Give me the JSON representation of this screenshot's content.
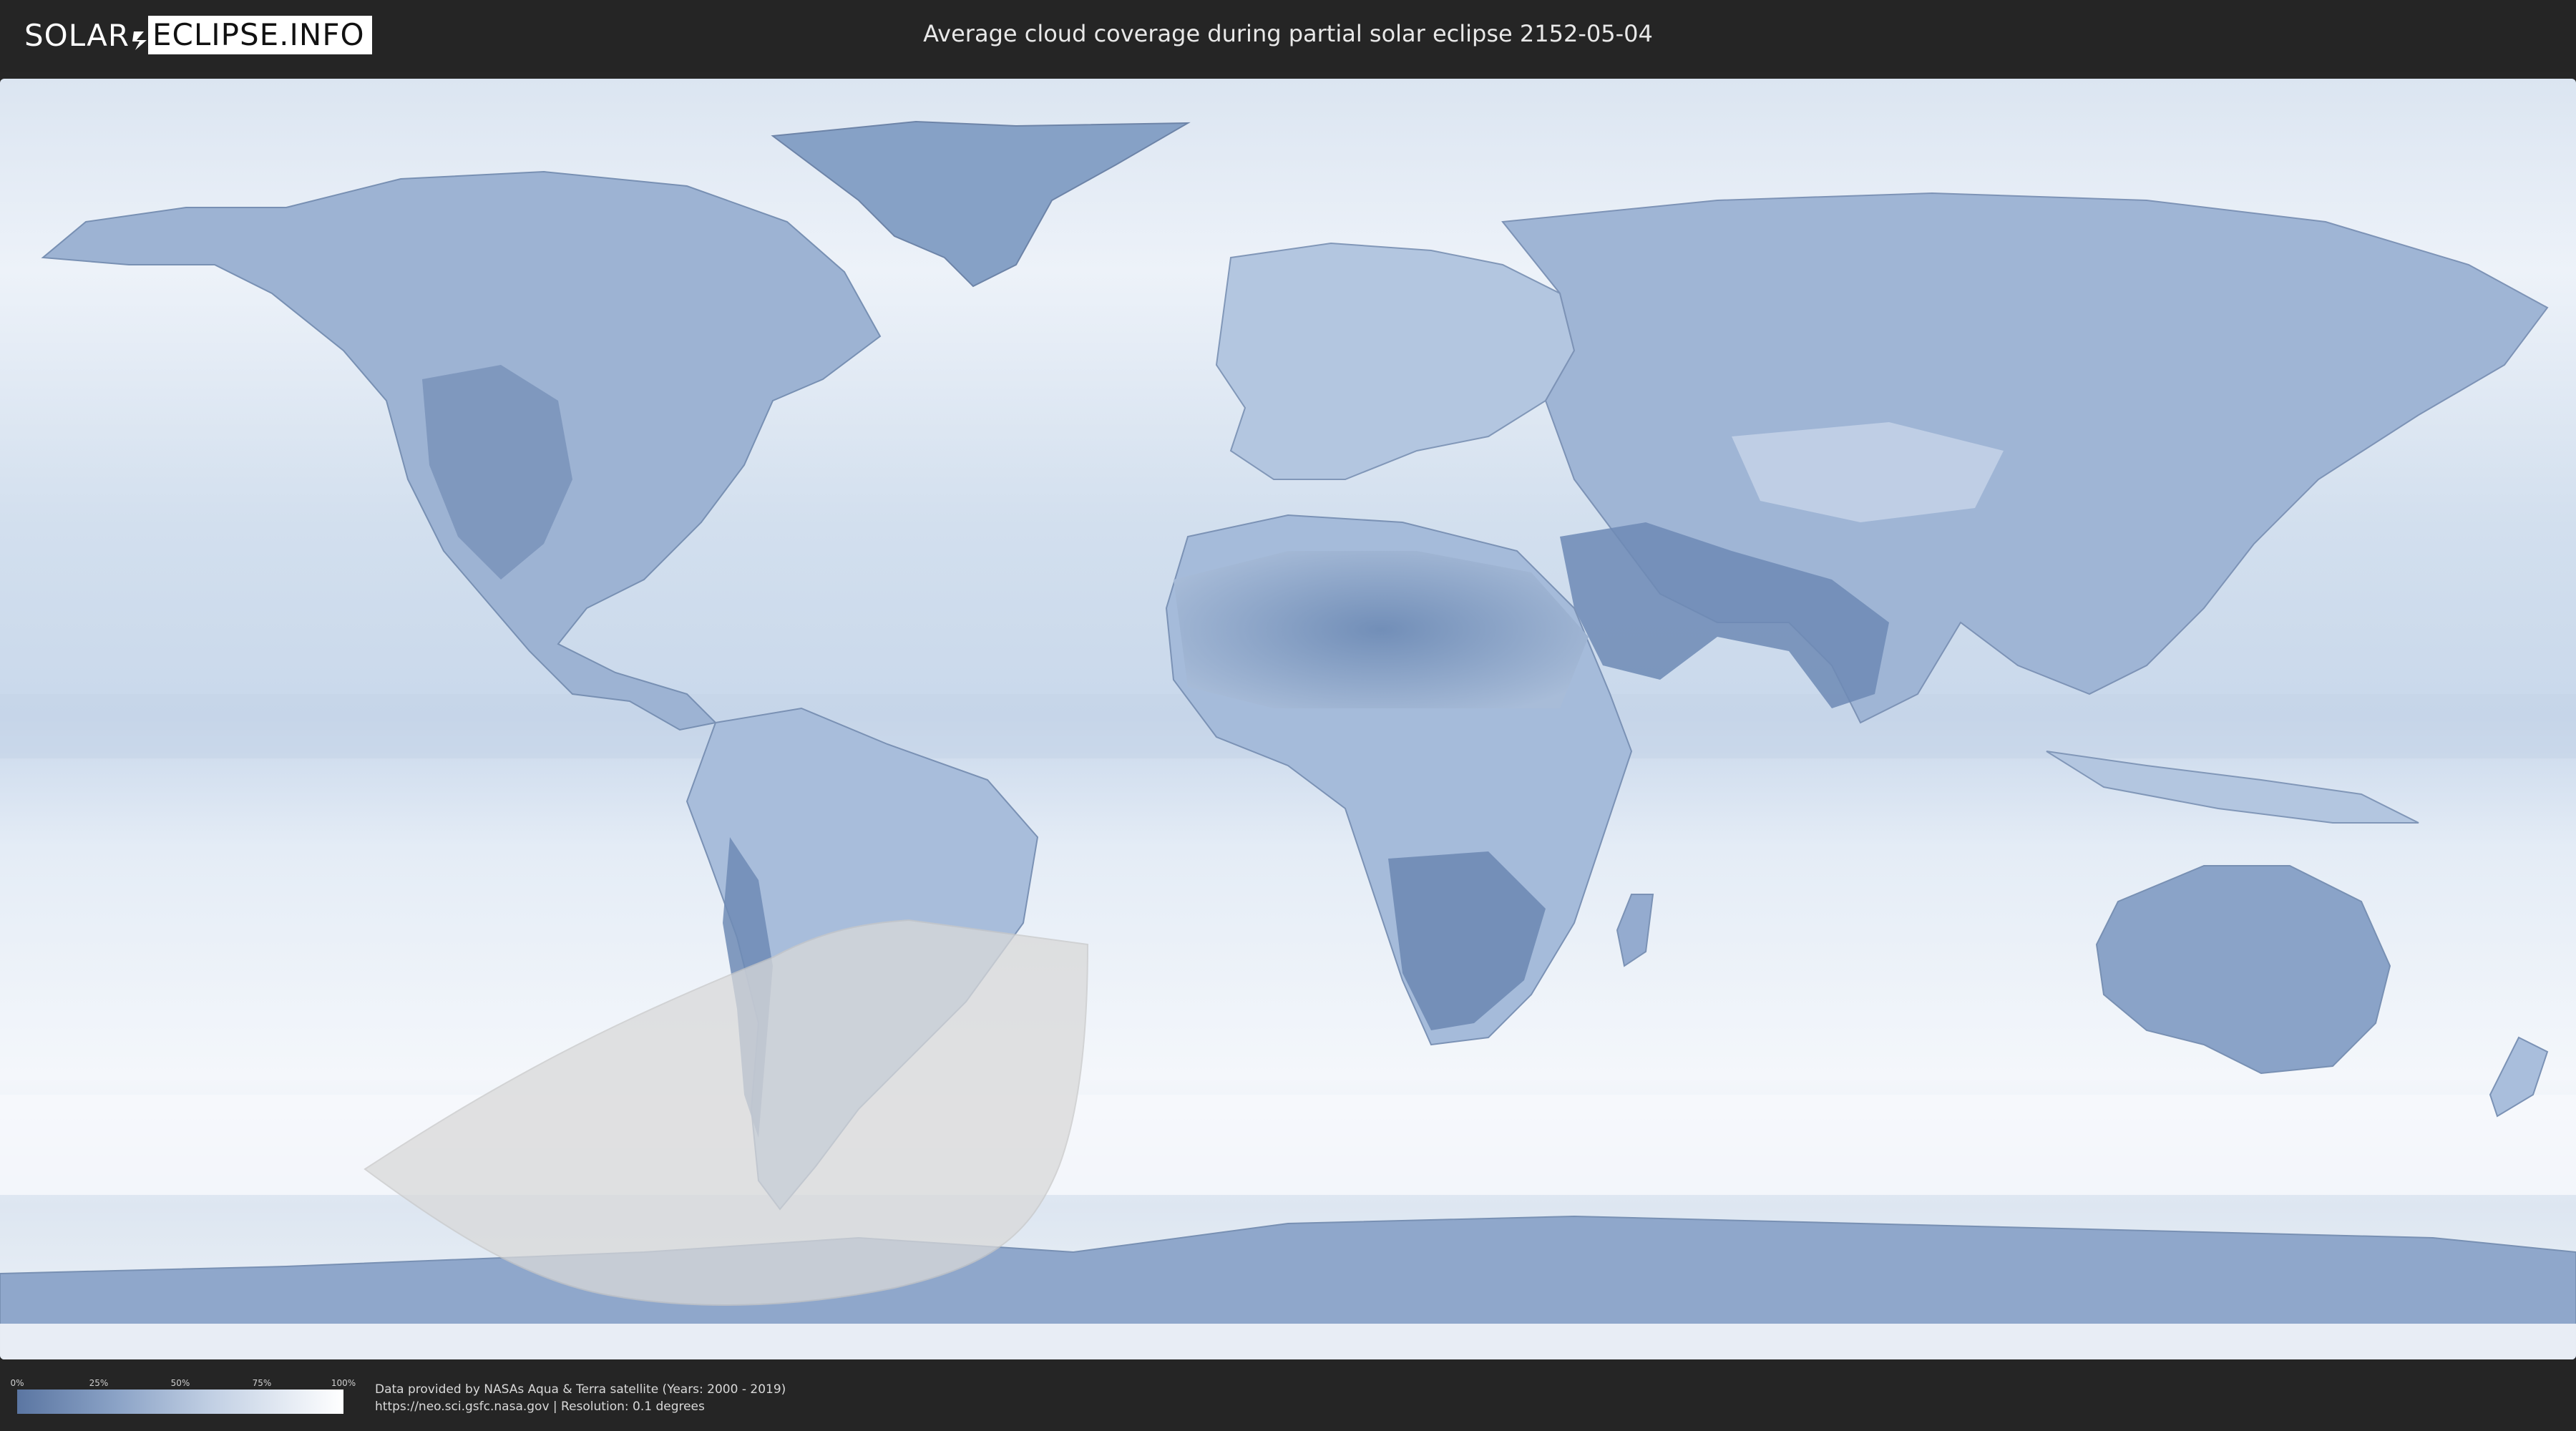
{
  "header": {
    "logo_left": "SOLAR",
    "logo_right": "ECLIPSE.INFO",
    "title": "Average cloud coverage during partial solar eclipse 2152-05-04"
  },
  "map": {
    "eclipse_visibility_region_color": "#d9d9d9",
    "ocean_color": "#e8eef7",
    "land_cloud_color": "#7e99c0"
  },
  "legend": {
    "ticks": [
      "0%",
      "25%",
      "50%",
      "75%",
      "100%"
    ],
    "gradient_start": "#5b76a2",
    "gradient_end": "#ffffff"
  },
  "footer": {
    "credit_line_1": "Data provided by NASAs Aqua & Terra satellite (Years: 2000 - 2019)",
    "credit_line_2": "https://neo.sci.gsfc.nasa.gov | Resolution: 0.1 degrees"
  }
}
